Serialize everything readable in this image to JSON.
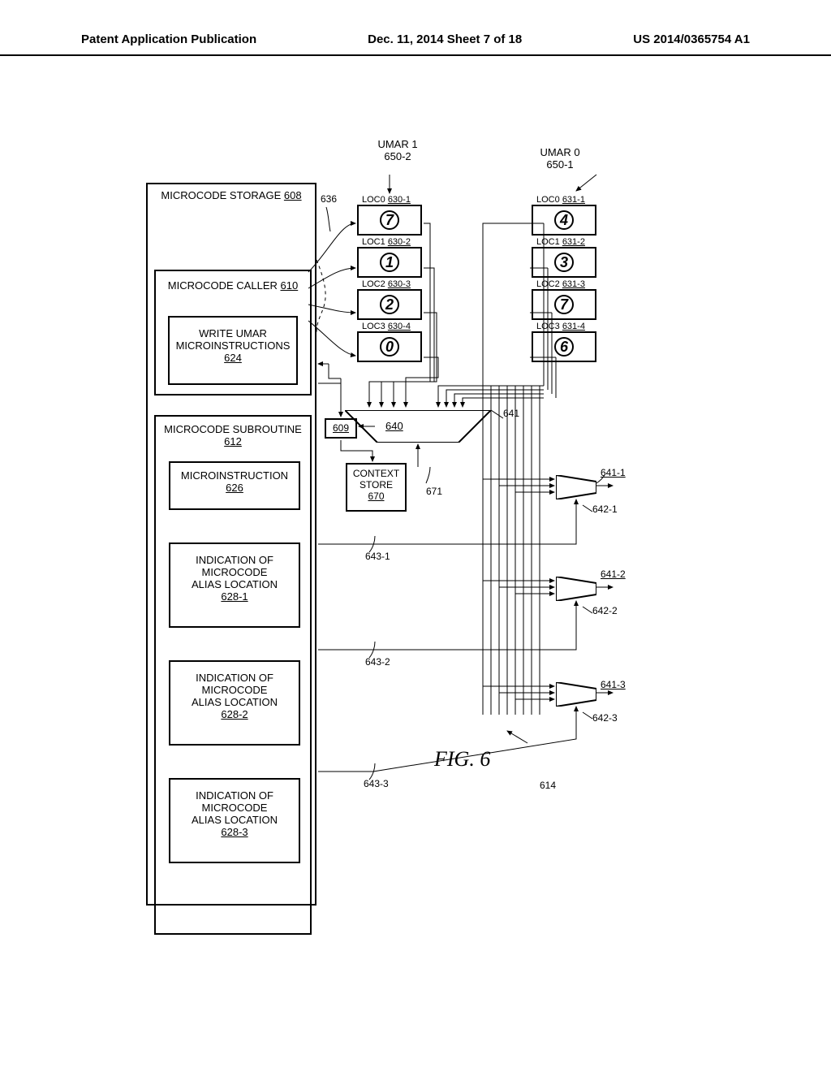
{
  "header": {
    "left": "Patent Application Publication",
    "mid": "Dec. 11, 2014 Sheet 7 of 18",
    "right": "US 2014/0365754 A1"
  },
  "storage": {
    "title": "MICROCODE STORAGE",
    "ref": "608"
  },
  "caller": {
    "title": "MICROCODE CALLER",
    "ref": "610"
  },
  "write_umar": {
    "line1": "WRITE UMAR",
    "line2": "MICROINSTRUCTIONS",
    "ref": "624"
  },
  "subroutine": {
    "title": "MICROCODE SUBROUTINE",
    "ref": "612"
  },
  "microinst": {
    "title": "MICROINSTRUCTION",
    "ref": "626"
  },
  "alias1": {
    "line1": "INDICATION OF",
    "line2": "MICROCODE",
    "line3": "ALIAS LOCATION",
    "ref": "628-1"
  },
  "alias2": {
    "line1": "INDICATION OF",
    "line2": "MICROCODE",
    "line3": "ALIAS LOCATION",
    "ref": "628-2"
  },
  "alias3": {
    "line1": "INDICATION OF",
    "line2": "MICROCODE",
    "line3": "ALIAS LOCATION",
    "ref": "628-3"
  },
  "umar1": {
    "title": "UMAR 1",
    "ref": "650-2",
    "loc0": {
      "label": "LOC0",
      "ref": "630-1",
      "val": "7"
    },
    "loc1": {
      "label": "LOC1",
      "ref": "630-2",
      "val": "1"
    },
    "loc2": {
      "label": "LOC2",
      "ref": "630-3",
      "val": "2"
    },
    "loc3": {
      "label": "LOC3",
      "ref": "630-4",
      "val": "0"
    }
  },
  "umar0": {
    "title": "UMAR 0",
    "ref": "650-1",
    "loc0": {
      "label": "LOC0",
      "ref": "631-1",
      "val": "4"
    },
    "loc1": {
      "label": "LOC1",
      "ref": "631-2",
      "val": "3"
    },
    "loc2": {
      "label": "LOC2",
      "ref": "631-3",
      "val": "7"
    },
    "loc3": {
      "label": "LOC3",
      "ref": "631-4",
      "val": "6"
    }
  },
  "context": {
    "line1": "CONTEXT",
    "line2": "STORE",
    "ref": "670"
  },
  "refs": {
    "r636": "636",
    "r609": "609",
    "r640": "640",
    "r641": "641",
    "r671": "671",
    "r614": "614",
    "r641_1": "641-1",
    "r641_2": "641-2",
    "r641_3": "641-3",
    "r642_1": "642-1",
    "r642_2": "642-2",
    "r642_3": "642-3",
    "r643_1": "643-1",
    "r643_2": "643-2",
    "r643_3": "643-3"
  },
  "fig": "FIG. 6"
}
